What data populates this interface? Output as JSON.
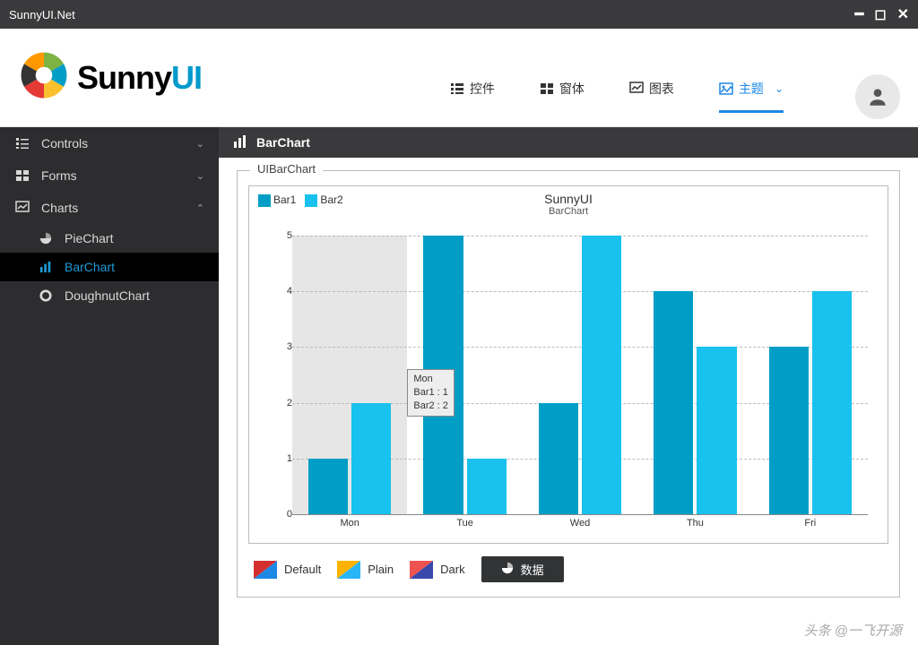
{
  "window": {
    "title": "SunnyUI.Net"
  },
  "logo": {
    "text_a": "Sunny",
    "text_b": "UI"
  },
  "topnav": [
    {
      "label": "控件",
      "active": false
    },
    {
      "label": "窗体",
      "active": false
    },
    {
      "label": "图表",
      "active": false
    },
    {
      "label": "主题",
      "active": true
    }
  ],
  "sidebar": {
    "groups": [
      {
        "label": "Controls",
        "expanded": false,
        "children": []
      },
      {
        "label": "Forms",
        "expanded": false,
        "children": []
      },
      {
        "label": "Charts",
        "expanded": true,
        "children": [
          {
            "label": "PieChart",
            "active": false
          },
          {
            "label": "BarChart",
            "active": true
          },
          {
            "label": "DoughnutChart",
            "active": false
          }
        ]
      }
    ]
  },
  "content": {
    "header": "BarChart",
    "frame_title": "UIBarChart"
  },
  "chart_data": {
    "type": "bar",
    "title": "SunnyUI",
    "subtitle": "BarChart",
    "xlabel": "",
    "ylabel": "",
    "ylim": [
      0,
      5
    ],
    "yticks": [
      0,
      1,
      2,
      3,
      4,
      5
    ],
    "categories": [
      "Mon",
      "Tue",
      "Wed",
      "Thu",
      "Fri"
    ],
    "series": [
      {
        "name": "Bar1",
        "color": "#009ec6",
        "values": [
          1,
          5,
          2,
          4,
          3
        ]
      },
      {
        "name": "Bar2",
        "color": "#18c1ee",
        "values": [
          2,
          1,
          5,
          3,
          4
        ]
      }
    ],
    "highlight_index": 0,
    "tooltip": {
      "category": "Mon",
      "lines": [
        "Mon",
        "Bar1 : 1",
        "Bar2 : 2"
      ]
    }
  },
  "themes": {
    "options": [
      "Default",
      "Plain",
      "Dark"
    ],
    "data_button": "数据"
  },
  "colors": {
    "accent": "#1e88e5",
    "bar1": "#009ec6",
    "bar2": "#18c1ee"
  },
  "watermark": "头条 @一飞开源"
}
